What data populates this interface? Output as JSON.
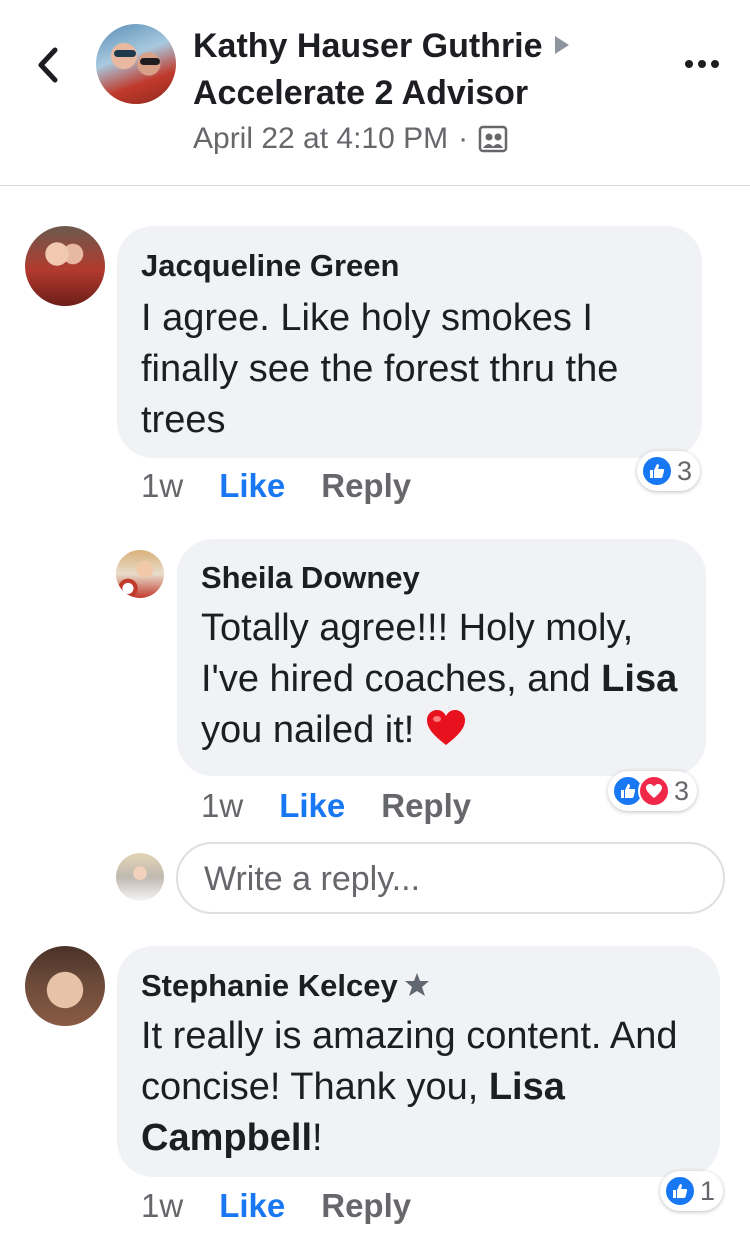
{
  "header": {
    "author_name": "Kathy Hauser Guthrie",
    "group_name": "Accelerate 2 Advisor",
    "timestamp": "April 22 at 4:10 PM",
    "separator": "·",
    "privacy_icon": "members-icon",
    "back_icon": "chevron-left-icon",
    "more_icon": "more-dots-icon"
  },
  "comments": [
    {
      "author": "Jacqueline Green",
      "text": "I agree. Like holy smokes I finally see the forest thru the trees",
      "time": "1w",
      "like_label": "Like",
      "reply_label": "Reply",
      "reaction_count": "3",
      "reactions": [
        "like"
      ],
      "replies": [
        {
          "author": "Sheila Downey",
          "text_before": "Totally agree!!! Holy moly, I've hired coaches, and ",
          "mention": "Lisa",
          "text_after": " you nailed it! ",
          "time": "1w",
          "like_label": "Like",
          "reply_label": "Reply",
          "reaction_count": "3",
          "reactions": [
            "like",
            "love"
          ]
        }
      ],
      "reply_placeholder": "Write a reply..."
    },
    {
      "author": "Stephanie Kelcey",
      "badge_icon": "star-badge-icon",
      "text_before": "It really is amazing content. And concise! Thank you, ",
      "mention": "Lisa Campbell",
      "text_after": "!",
      "time": "1w",
      "like_label": "Like",
      "reply_label": "Reply",
      "reaction_count": "1",
      "reactions": [
        "like"
      ]
    }
  ],
  "colors": {
    "link_blue": "#1877f2",
    "bubble_gray": "#f0f2f5",
    "meta_gray": "#65676b",
    "love_red": "#f02849"
  }
}
